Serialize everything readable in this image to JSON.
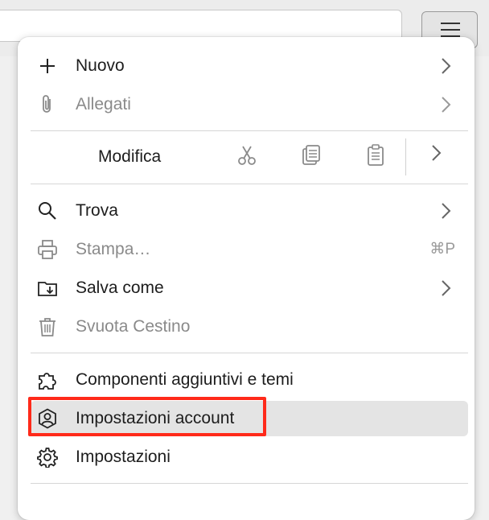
{
  "menu": {
    "items": [
      {
        "label": "Nuovo",
        "icon": "plus-icon",
        "submenu": true,
        "enabled": true
      },
      {
        "label": "Allegati",
        "icon": "paperclip-icon",
        "submenu": true,
        "enabled": false
      },
      {
        "label": "Trova",
        "icon": "search-icon",
        "submenu": true,
        "enabled": true
      },
      {
        "label": "Stampa…",
        "icon": "printer-icon",
        "shortcut": "⌘P",
        "enabled": false
      },
      {
        "label": "Salva come",
        "icon": "save-folder-icon",
        "submenu": true,
        "enabled": true
      },
      {
        "label": "Svuota Cestino",
        "icon": "trash-icon",
        "enabled": false
      },
      {
        "label": "Componenti aggiuntivi e temi",
        "icon": "puzzle-icon",
        "enabled": true
      },
      {
        "label": "Impostazioni account",
        "icon": "account-icon",
        "enabled": true,
        "highlighted": true
      },
      {
        "label": "Impostazioni",
        "icon": "gear-icon",
        "enabled": true
      }
    ],
    "edit": {
      "label": "Modifica",
      "actions": [
        "scissors-icon",
        "copy-icon",
        "paste-icon"
      ]
    }
  },
  "colors": {
    "focus_ring": "#ff2a1a",
    "highlight_bg": "#e4e4e4",
    "disabled_text": "#8a8a8a"
  }
}
